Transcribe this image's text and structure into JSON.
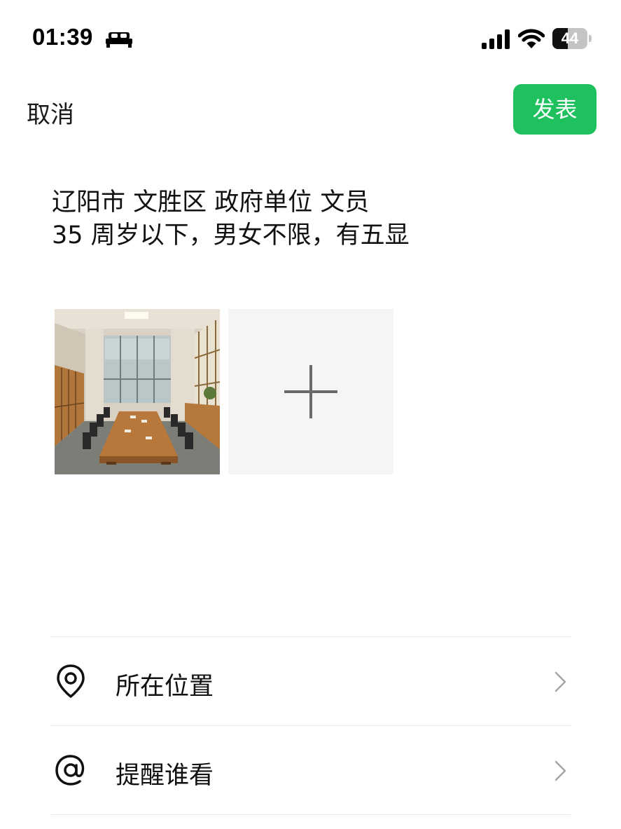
{
  "status_bar": {
    "time": "01:39",
    "battery_level": "44",
    "battery_fraction": 0.44,
    "icons": [
      "sleep-focus-icon",
      "cellular-signal-icon",
      "wifi-icon",
      "battery-icon"
    ]
  },
  "header": {
    "cancel_label": "取消",
    "publish_label": "发表",
    "publish_color": "#1fc15f"
  },
  "post": {
    "lines": [
      "辽阳市 文胜区 政府单位 文员",
      "35 周岁以下，男女不限，有五显"
    ]
  },
  "photos": {
    "items": [
      {
        "subject": "conference-room-photo"
      }
    ],
    "add_icon": "plus-icon"
  },
  "options": [
    {
      "label": "所在位置",
      "icon": "location-pin-icon"
    },
    {
      "label": "提醒谁看",
      "icon": "at-sign-icon"
    }
  ]
}
